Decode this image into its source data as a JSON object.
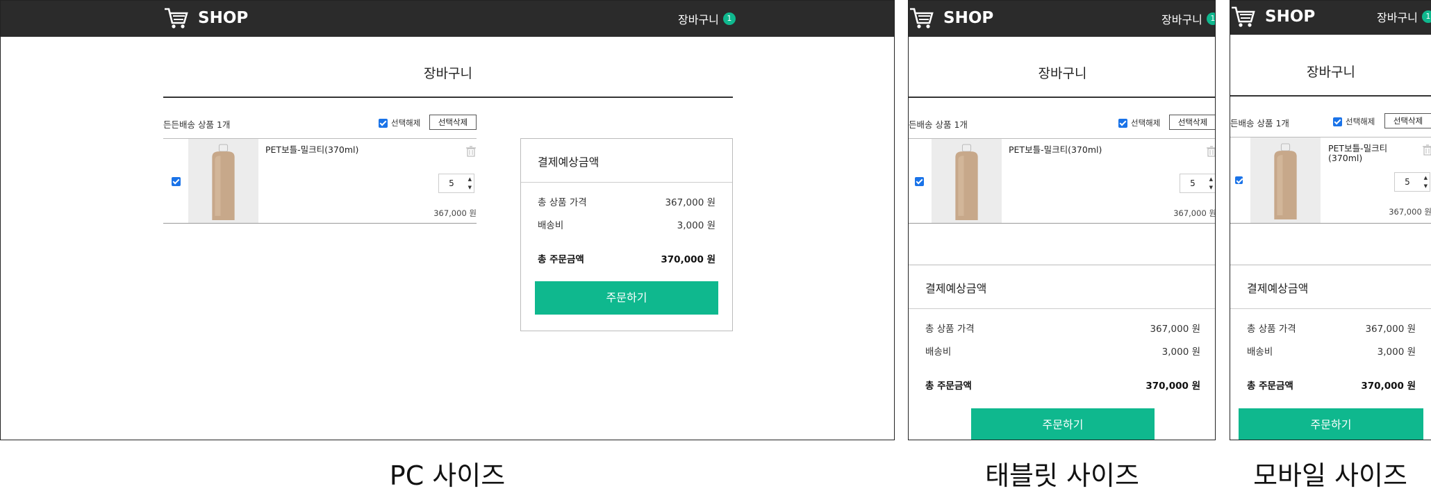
{
  "colors": {
    "accent": "#0fb88e",
    "header_bg": "#2b2b2b",
    "checkbox": "#1a73e8"
  },
  "header": {
    "logo_text": "SHOP",
    "cart_label": "장바구니",
    "cart_count": "1",
    "logo_icon": "shopping-cart-icon"
  },
  "page": {
    "title": "장바구니"
  },
  "cart": {
    "group_label": "든든배송 상품 1개",
    "group_label_cut": "든배송 상품 1개",
    "select_all_label": "선택해제",
    "delete_selected_label": "선택삭제",
    "item": {
      "name": "PET보틀-밀크티(370ml)",
      "name_line1": "PET보틀-밀크티",
      "name_line2": "(370ml)",
      "quantity": "5",
      "price": "367,000 원",
      "checked": true
    }
  },
  "summary": {
    "title": "결제예상금액",
    "rows": [
      {
        "label": "총 상품 가격",
        "value": "367,000 원"
      },
      {
        "label": "배송비",
        "value": "3,000 원"
      }
    ],
    "total": {
      "label": "총 주문금액",
      "value": "370,000 원"
    },
    "order_button": "주문하기"
  },
  "captions": {
    "pc": "PC 사이즈",
    "tablet": "태블릿 사이즈",
    "mobile": "모바일 사이즈"
  }
}
